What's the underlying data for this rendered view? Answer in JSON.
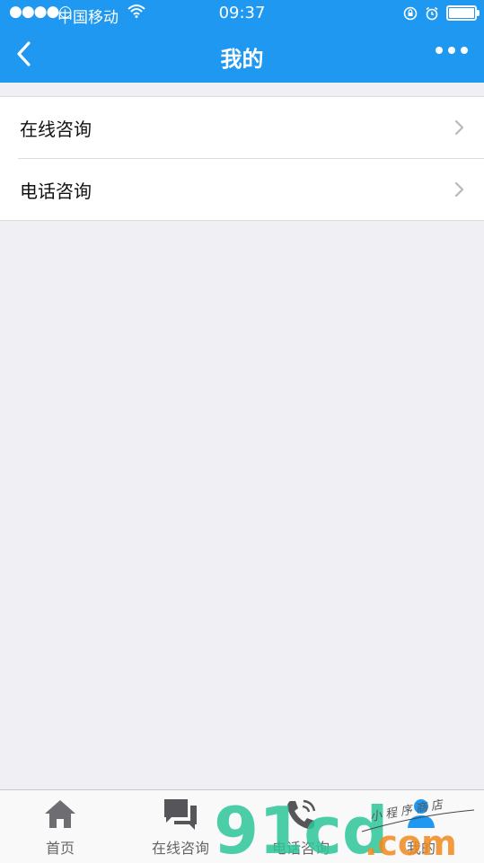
{
  "status_bar": {
    "signal": "●●●●○",
    "carrier": "中国移动",
    "time": "09:37"
  },
  "navbar": {
    "title": "我的",
    "back_icon": "chevron-left-icon",
    "more_icon": "more-dots-icon"
  },
  "list": {
    "items": [
      {
        "label": "在线咨询",
        "icon": "chevron-right-icon"
      },
      {
        "label": "电话咨询",
        "icon": "chevron-right-icon"
      }
    ]
  },
  "tabbar": {
    "tabs": [
      {
        "label": "首页",
        "icon": "home-icon"
      },
      {
        "label": "在线咨询",
        "icon": "chat-icon"
      },
      {
        "label": "电话咨询",
        "icon": "phone-icon"
      },
      {
        "label": "我的",
        "icon": "user-icon"
      }
    ]
  },
  "watermark": {
    "brand": "91cd",
    "domain": ".com",
    "tagline": "小 程 序 商 店"
  },
  "colors": {
    "header": "#1e98f0",
    "background": "#efeff4",
    "watermark_green": "#2dc79a",
    "watermark_orange": "#f08a1e"
  }
}
